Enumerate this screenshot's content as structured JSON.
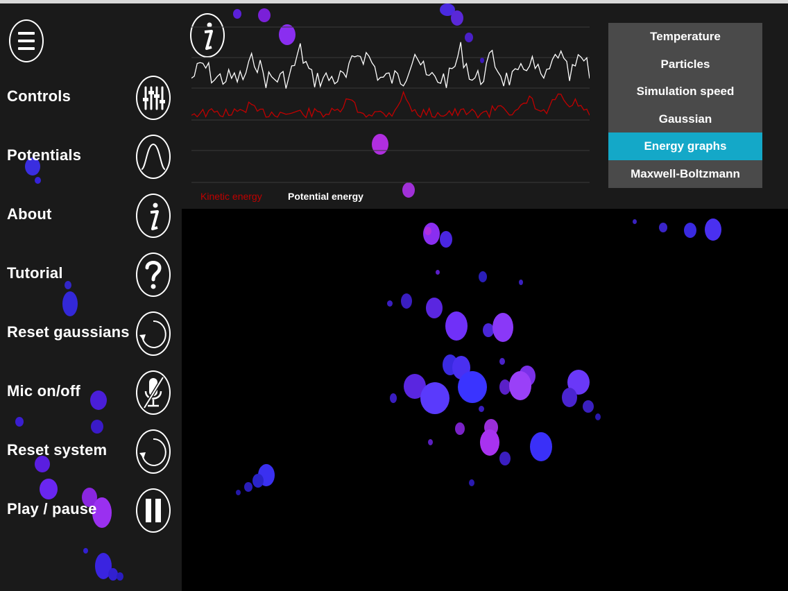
{
  "sidebar": {
    "items": [
      {
        "label": "Controls",
        "icon": "sliders-icon"
      },
      {
        "label": "Potentials",
        "icon": "wave-icon"
      },
      {
        "label": "About",
        "icon": "info-icon"
      },
      {
        "label": "Tutorial",
        "icon": "question-icon"
      },
      {
        "label": "Reset gaussians",
        "icon": "reset-icon"
      },
      {
        "label": "Mic on/off",
        "icon": "mic-off-icon"
      },
      {
        "label": "Reset system",
        "icon": "reset-icon"
      },
      {
        "label": "Play / pause",
        "icon": "pause-icon"
      }
    ]
  },
  "graph": {
    "legend": {
      "kinetic": "Kinetic energy",
      "potential": "Potential energy"
    },
    "colors": {
      "kinetic": "#c00000",
      "potential": "#ffffff",
      "grid": "#3a3a3a"
    }
  },
  "dropdown": {
    "items": [
      "Temperature",
      "Particles",
      "Simulation speed",
      "Gaussian",
      "Energy graphs",
      "Maxwell-Boltzmann"
    ],
    "selected": "Energy graphs",
    "active_color": "#14a8c8"
  }
}
